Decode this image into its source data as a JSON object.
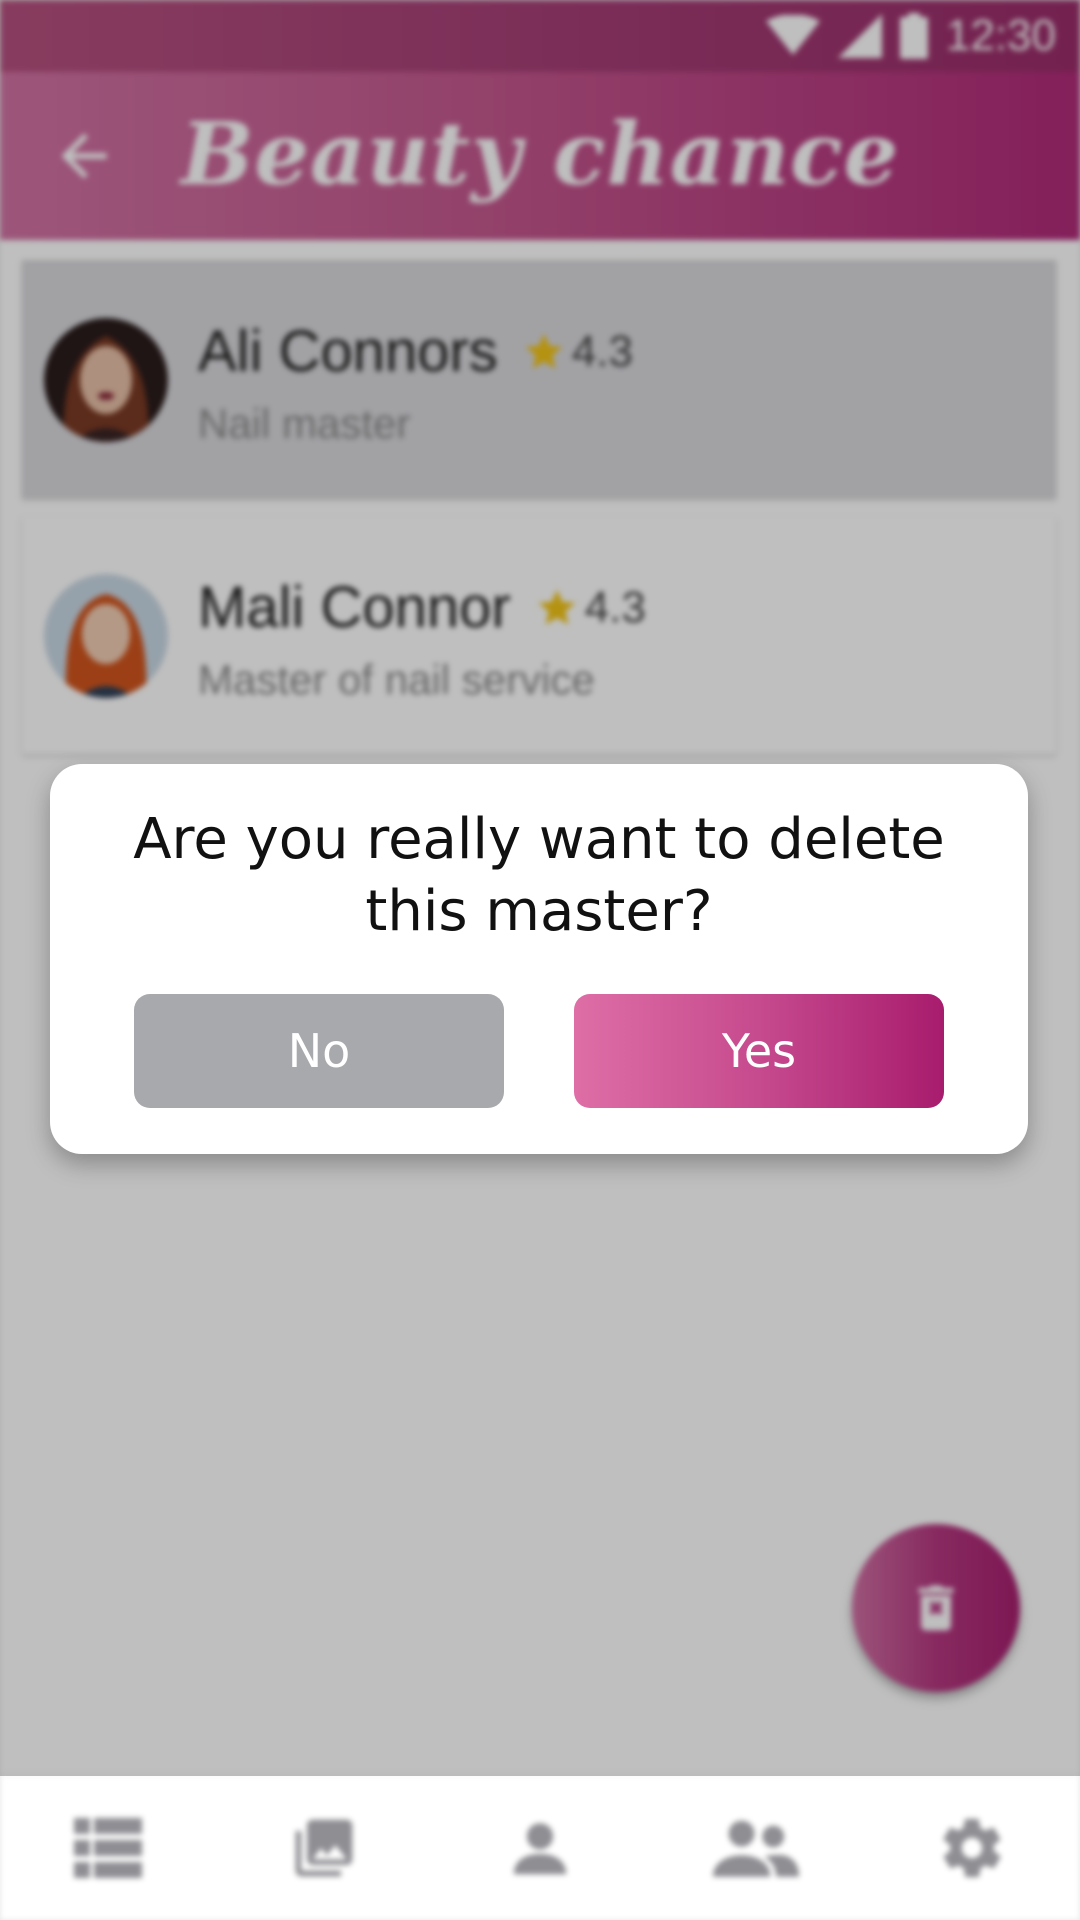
{
  "status_bar": {
    "time": "12:30",
    "icons": [
      "wifi-icon",
      "cell-signal-icon",
      "battery-icon"
    ]
  },
  "toolbar": {
    "title": "Beauty chance",
    "back_icon": "arrow-back-icon"
  },
  "masters": [
    {
      "name": "Ali Connors",
      "rating": "4.3",
      "role": "Nail master",
      "selected": true
    },
    {
      "name": "Mali Connor",
      "rating": "4.3",
      "role": "Master of nail service",
      "selected": false
    }
  ],
  "dialog": {
    "message": "Are you really want to delete this master?",
    "no_label": "No",
    "yes_label": "Yes"
  },
  "fab": {
    "icon": "delete-icon"
  },
  "bottom_nav": {
    "items": [
      "list-icon",
      "gallery-icon",
      "person-icon",
      "people-icon",
      "settings-icon"
    ]
  },
  "colors": {
    "brand_gradient_start": "#d173a3",
    "brand_gradient_end": "#a71f6f",
    "no_button": "#a8a9ad",
    "star": "#f2c417"
  }
}
